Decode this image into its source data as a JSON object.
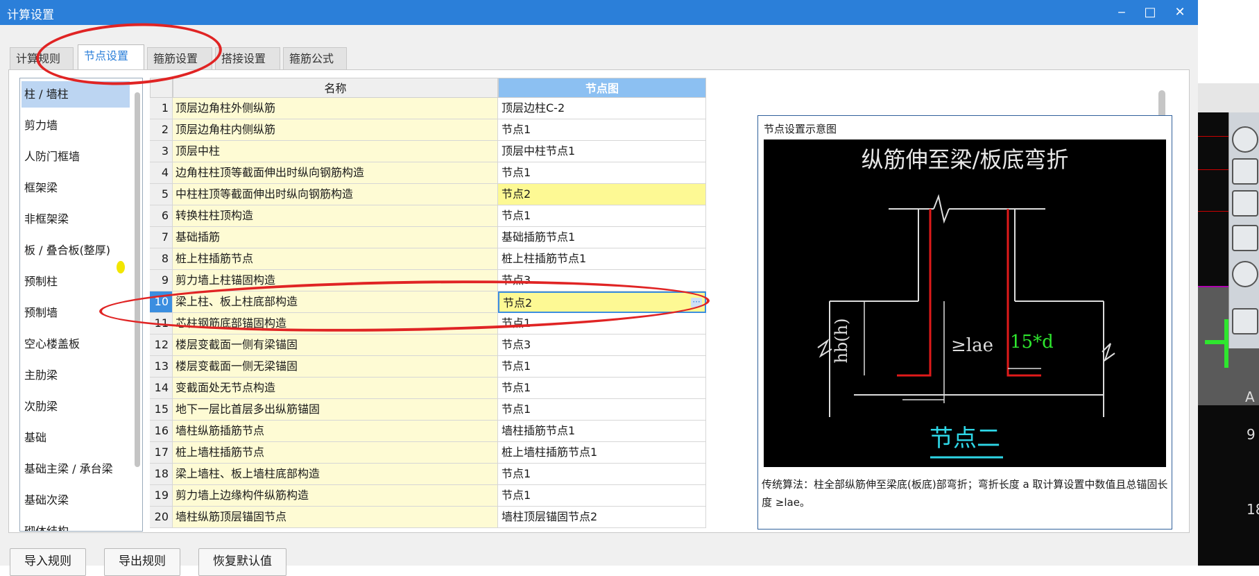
{
  "window": {
    "title": "计算设置",
    "minimize_icon": "minimize-icon",
    "maximize_icon": "maximize-icon",
    "close_icon": "close-icon"
  },
  "tabs": [
    {
      "label": "计算规则"
    },
    {
      "label": "节点设置"
    },
    {
      "label": "箍筋设置"
    },
    {
      "label": "搭接设置"
    },
    {
      "label": "箍筋公式"
    }
  ],
  "categories": [
    {
      "label": "柱 / 墙柱"
    },
    {
      "label": "剪力墙"
    },
    {
      "label": "人防门框墙"
    },
    {
      "label": "框架梁"
    },
    {
      "label": "非框架梁"
    },
    {
      "label": "板 / 叠合板(整厚)"
    },
    {
      "label": "预制柱"
    },
    {
      "label": "预制墙"
    },
    {
      "label": "空心楼盖板"
    },
    {
      "label": "主肋梁"
    },
    {
      "label": "次肋梁"
    },
    {
      "label": "基础"
    },
    {
      "label": "基础主梁 / 承台梁"
    },
    {
      "label": "基础次梁"
    },
    {
      "label": "砌体结构"
    }
  ],
  "table": {
    "headers": {
      "name": "名称",
      "node": "节点图"
    },
    "rows": [
      {
        "num": "1",
        "name": "顶层边角柱外侧纵筋",
        "node": "顶层边柱C-2"
      },
      {
        "num": "2",
        "name": "顶层边角柱内侧纵筋",
        "node": "节点1"
      },
      {
        "num": "3",
        "name": "顶层中柱",
        "node": "顶层中柱节点1"
      },
      {
        "num": "4",
        "name": "边角柱柱顶等截面伸出时纵向钢筋构造",
        "node": "节点1"
      },
      {
        "num": "5",
        "name": "中柱柱顶等截面伸出时纵向钢筋构造",
        "node": "节点2"
      },
      {
        "num": "6",
        "name": "转换柱柱顶构造",
        "node": "节点1"
      },
      {
        "num": "7",
        "name": "基础插筋",
        "node": "基础插筋节点1"
      },
      {
        "num": "8",
        "name": "桩上柱插筋节点",
        "node": "桩上柱插筋节点1"
      },
      {
        "num": "9",
        "name": "剪力墙上柱锚固构造",
        "node": "节点3"
      },
      {
        "num": "10",
        "name": "梁上柱、板上柱底部构造",
        "node": "节点2"
      },
      {
        "num": "11",
        "name": "芯柱钢筋底部锚固构造",
        "node": "节点1"
      },
      {
        "num": "12",
        "name": "楼层变截面一侧有梁锚固",
        "node": "节点3"
      },
      {
        "num": "13",
        "name": "楼层变截面一侧无梁锚固",
        "node": "节点1"
      },
      {
        "num": "14",
        "name": "变截面处无节点构造",
        "node": "节点1"
      },
      {
        "num": "15",
        "name": "地下一层比首层多出纵筋锚固",
        "node": "节点1"
      },
      {
        "num": "16",
        "name": "墙柱纵筋插筋节点",
        "node": "墙柱插筋节点1"
      },
      {
        "num": "17",
        "name": "桩上墙柱插筋节点",
        "node": "桩上墙柱插筋节点1"
      },
      {
        "num": "18",
        "name": "梁上墙柱、板上墙柱底部构造",
        "node": "节点1"
      },
      {
        "num": "19",
        "name": "剪力墙上边缘构件纵筋构造",
        "node": "节点1"
      },
      {
        "num": "20",
        "name": "墙柱纵筋顶层锚固节点",
        "node": "墙柱顶层锚固节点2"
      }
    ],
    "ellipsis": "···"
  },
  "preview": {
    "title": "节点设置示意图",
    "diagram_heading": "纵筋伸至梁/板底弯折",
    "dim_hb": "hb(h)",
    "dim_lae": "≥lae",
    "dim_15d": "15*d",
    "diagram_caption": "节点二",
    "description": "传统算法：柱全部纵筋伸至梁底(板底)部弯折；弯折长度 a 取计算设置中数值且总锚固长度 ≥lae。"
  },
  "buttons": {
    "import": "导入规则",
    "export": "导出规则",
    "restore": "恢复默认值"
  },
  "background_app": {
    "labels": [
      "A",
      "9",
      "18"
    ]
  },
  "colors": {
    "titlebar": "#2b7fd9",
    "selected_row": "#3b8ee0",
    "highlight_cell": "#fdf994",
    "name_cell": "#fefbd4",
    "annotation": "#e02424"
  }
}
